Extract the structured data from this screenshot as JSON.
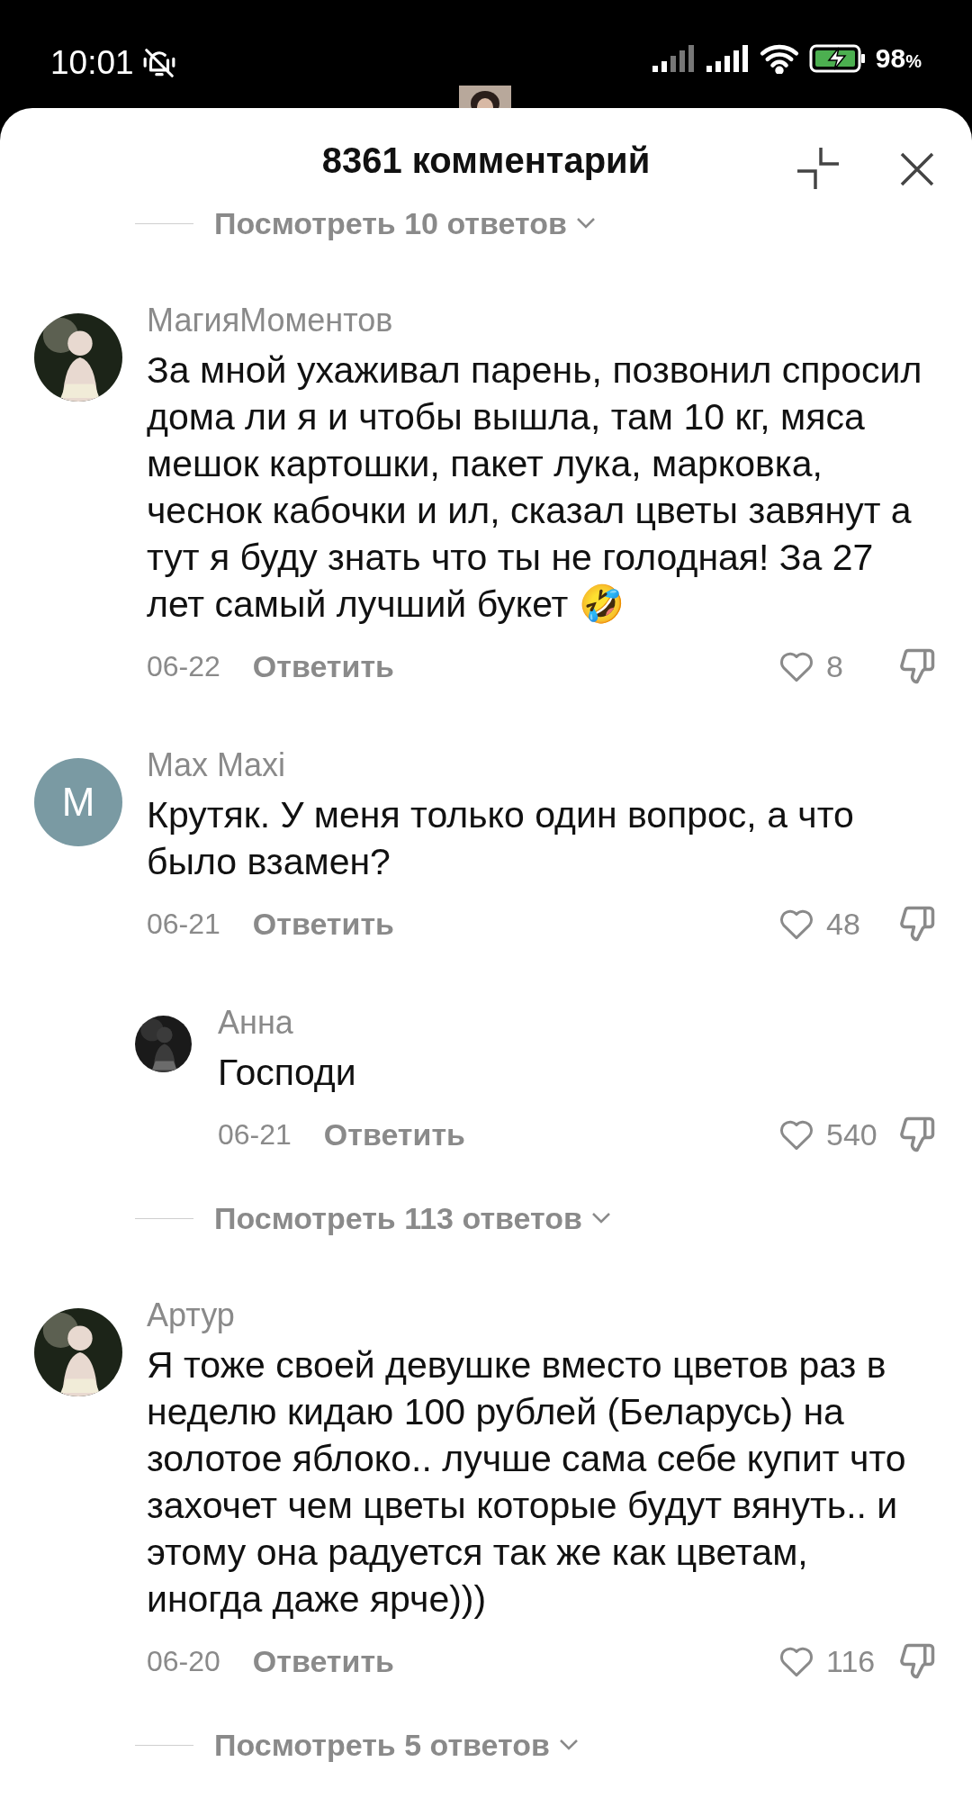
{
  "status_bar": {
    "time": "10:01",
    "battery": "98",
    "battery_unit": "%"
  },
  "header": {
    "title": "8361 комментарий"
  },
  "items": [
    {
      "kind": "view_replies",
      "label": "Посмотреть 10 ответов"
    },
    {
      "kind": "comment",
      "author": "МагияМоментов",
      "text": "За мной ухаживал парень, позвонил спросил дома ли я и чтобы вышла, там 10 кг, мяса мешок картошки, пакет лука, марковка, чеснок кабочки и ил, сказал цветы завянут а тут я буду знать что ты не голодная! За 27 лет самый лучший букет 🤣",
      "date": "06-22",
      "reply": "Ответить",
      "likes": "8"
    },
    {
      "kind": "comment",
      "author": "Max Maxi",
      "avatar": {
        "kind": "letter",
        "letter": "M",
        "color": "#7a9aa3"
      },
      "text": "Крутяк. У меня только один вопрос, а что было взамен?",
      "date": "06-21",
      "reply": "Ответить",
      "likes": "48"
    },
    {
      "kind": "reply",
      "author": "Анна",
      "text": "Господи",
      "date": "06-21",
      "reply": "Ответить",
      "likes": "540"
    },
    {
      "kind": "view_replies",
      "label": "Посмотреть 113 ответов"
    },
    {
      "kind": "comment",
      "author": "Артур",
      "text": "Я тоже своей девушке вместо цветов раз в неделю кидаю 100 рублей (Беларусь) на золотое яблоко.. лучше сама себе купит что захочет чем цветы которые будут вянуть.. и этому она радуется так же как цветам, иногда даже ярче)))",
      "date": "06-20",
      "reply": "Ответить",
      "likes": "116"
    },
    {
      "kind": "view_replies",
      "label": "Посмотреть 5 ответов"
    }
  ]
}
